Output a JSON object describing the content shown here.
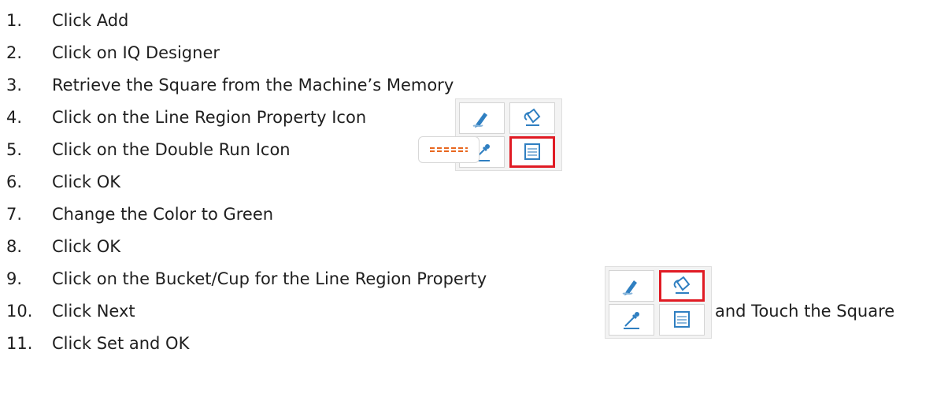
{
  "steps": [
    {
      "number": "1.",
      "text": "Click Add"
    },
    {
      "number": "2.",
      "text": "Click on IQ Designer"
    },
    {
      "number": "3.",
      "text": "Retrieve the Square from the Machine’s Memory"
    },
    {
      "number": "4.",
      "text": "Click on the Line Region Property Icon"
    },
    {
      "number": "5.",
      "text": "Click on the Double Run Icon"
    },
    {
      "number": "6.",
      "text": "Click OK"
    },
    {
      "number": "7.",
      "text": "Change the Color to Green"
    },
    {
      "number": "8.",
      "text": "Click OK"
    },
    {
      "number": "9.",
      "text": "Click on the Bucket/Cup for the Line Region Property",
      "suffix": "and Touch the Square"
    },
    {
      "number": "10.",
      "text": "Click Next"
    },
    {
      "number": "11.",
      "text": "Click Set and OK"
    }
  ],
  "icons": {
    "panel_1": {
      "items": [
        "pen-icon",
        "bucket-icon",
        "eyedropper-icon",
        "line-region-property-icon"
      ],
      "selected": "line-region-property-icon"
    },
    "panel_2": {
      "items": [
        "pen-icon",
        "bucket-icon",
        "eyedropper-icon",
        "line-region-property-icon"
      ],
      "selected": "bucket-icon"
    },
    "double_run": "double-run-icon"
  },
  "colors": {
    "accent_blue": "#2f7fc1",
    "highlight_red": "#e01b24",
    "double_run_orange": "#e8671f"
  }
}
